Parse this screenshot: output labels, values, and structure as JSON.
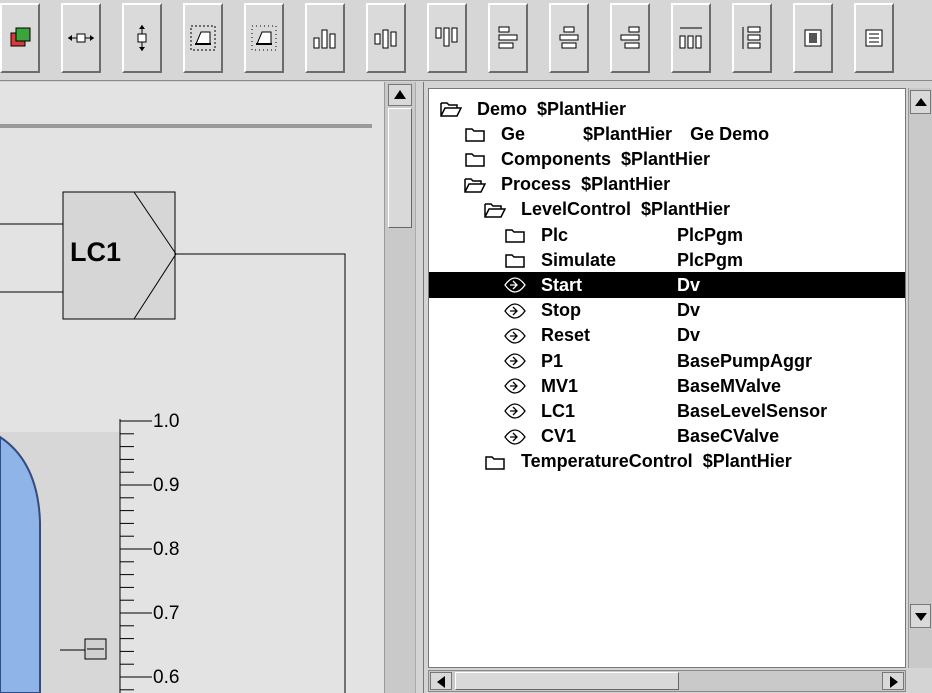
{
  "toolbar": {
    "buttons": [
      {
        "icon": "bring-to-front-icon"
      },
      {
        "icon": "horizontal-connect-icon"
      },
      {
        "icon": "vertical-connect-icon"
      },
      {
        "icon": "group-objects-icon"
      },
      {
        "icon": "ungroup-objects-icon"
      },
      {
        "icon": "align-bottom-icon"
      },
      {
        "icon": "align-center-vertical-icon"
      },
      {
        "icon": "align-top-icon"
      },
      {
        "icon": "align-left-icon"
      },
      {
        "icon": "align-center-horizontal-icon"
      },
      {
        "icon": "align-right-icon"
      },
      {
        "icon": "distribute-horizontal-icon"
      },
      {
        "icon": "distribute-vertical-icon"
      },
      {
        "icon": "object-attributes-icon"
      },
      {
        "icon": "list-icon"
      }
    ]
  },
  "canvas": {
    "controller_label": "LC1",
    "scale_labels": [
      "1.0",
      "0.9",
      "0.8",
      "0.7",
      "0.6"
    ]
  },
  "tree": {
    "items": [
      {
        "name": "Demo",
        "class": "$PlantHier",
        "desc": "",
        "icon": "folder-open-icon",
        "level": 0
      },
      {
        "name": "Ge",
        "class": "$PlantHier",
        "desc": "Ge Demo",
        "icon": "folder-icon",
        "level": 1
      },
      {
        "name": "Components",
        "class": "$PlantHier",
        "desc": "",
        "icon": "folder-icon",
        "level": 1
      },
      {
        "name": "Process",
        "class": "$PlantHier",
        "desc": "",
        "icon": "folder-open-icon",
        "level": 1
      },
      {
        "name": "LevelControl",
        "class": "$PlantHier",
        "desc": "",
        "icon": "folder-open-icon",
        "level": 2
      },
      {
        "name": "Plc",
        "class": "PlcPgm",
        "desc": "",
        "icon": "folder-icon",
        "level": 3
      },
      {
        "name": "Simulate",
        "class": "PlcPgm",
        "desc": "",
        "icon": "folder-icon",
        "level": 3
      },
      {
        "name": "Start",
        "class": "Dv",
        "desc": "",
        "icon": "object-leaf-icon",
        "level": 3,
        "selected": true
      },
      {
        "name": "Stop",
        "class": "Dv",
        "desc": "",
        "icon": "object-leaf-icon",
        "level": 3
      },
      {
        "name": "Reset",
        "class": "Dv",
        "desc": "",
        "icon": "object-leaf-icon",
        "level": 3
      },
      {
        "name": "P1",
        "class": "BasePumpAggr",
        "desc": "",
        "icon": "object-leaf-icon",
        "level": 3
      },
      {
        "name": "MV1",
        "class": "BaseMValve",
        "desc": "",
        "icon": "object-leaf-icon",
        "level": 3
      },
      {
        "name": "LC1",
        "class": "BaseLevelSensor",
        "desc": "",
        "icon": "object-leaf-icon",
        "level": 3
      },
      {
        "name": "CV1",
        "class": "BaseCValve",
        "desc": "",
        "icon": "object-leaf-icon",
        "level": 3
      },
      {
        "name": "TemperatureControl",
        "class": "$PlantHier",
        "desc": "",
        "icon": "folder-icon",
        "level": 2
      }
    ]
  },
  "colors": {
    "tank_fill": "#8fb4e8",
    "tank_edge": "#2c4c8c",
    "selection_bg": "#000000",
    "canvas_bg": "#e3e3e3"
  }
}
